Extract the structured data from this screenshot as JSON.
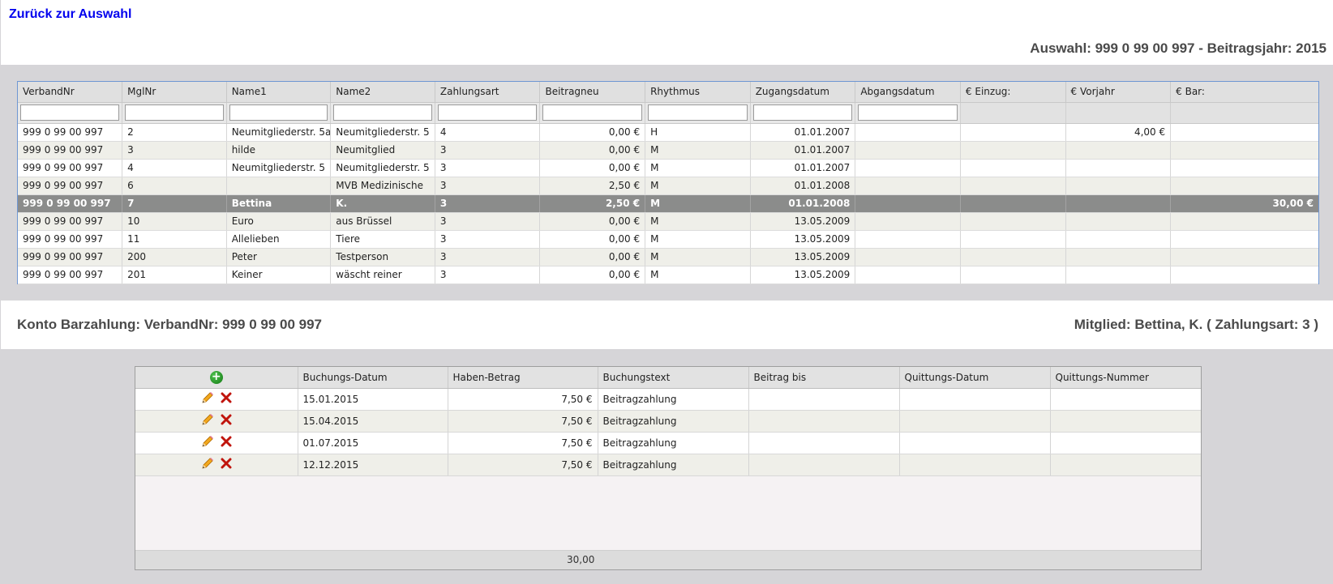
{
  "nav": {
    "back_label": "Zurück zur Auswahl"
  },
  "selection": {
    "heading": "Auswahl: 999 0 99 00 997 - Beitragsjahr: 2015"
  },
  "members_grid": {
    "columns": [
      "VerbandNr",
      "MglNr",
      "Name1",
      "Name2",
      "Zahlungsart",
      "Beitragneu",
      "Rhythmus",
      "Zugangsdatum",
      "Abgangsdatum",
      "€ Einzug:",
      "€ Vorjahr",
      "€ Bar:"
    ],
    "selected_index": 4,
    "rows": [
      {
        "verbandnr": "999 0 99 00 997",
        "mglnr": "2",
        "name1": "Neumitgliederstr. 5a",
        "name2": "Neumitgliederstr. 5",
        "zahlungsart": "4",
        "beitragneu": "0,00 €",
        "rhythmus": "H",
        "zugang": "01.01.2007",
        "abgang": "",
        "einzug": "",
        "vorjahr": "4,00 €",
        "bar": ""
      },
      {
        "verbandnr": "999 0 99 00 997",
        "mglnr": "3",
        "name1": "hilde",
        "name2": "Neumitglied",
        "zahlungsart": "3",
        "beitragneu": "0,00 €",
        "rhythmus": "M",
        "zugang": "01.01.2007",
        "abgang": "",
        "einzug": "",
        "vorjahr": "",
        "bar": ""
      },
      {
        "verbandnr": "999 0 99 00 997",
        "mglnr": "4",
        "name1": "Neumitgliederstr. 5",
        "name2": "Neumitgliederstr. 5",
        "zahlungsart": "3",
        "beitragneu": "0,00 €",
        "rhythmus": "M",
        "zugang": "01.01.2007",
        "abgang": "",
        "einzug": "",
        "vorjahr": "",
        "bar": ""
      },
      {
        "verbandnr": "999 0 99 00 997",
        "mglnr": "6",
        "name1": "",
        "name2": "MVB Medizinische",
        "zahlungsart": "3",
        "beitragneu": "2,50 €",
        "rhythmus": "M",
        "zugang": "01.01.2008",
        "abgang": "",
        "einzug": "",
        "vorjahr": "",
        "bar": ""
      },
      {
        "verbandnr": "999 0 99 00 997",
        "mglnr": "7",
        "name1": "Bettina",
        "name2": "K.",
        "zahlungsart": "3",
        "beitragneu": "2,50 €",
        "rhythmus": "M",
        "zugang": "01.01.2008",
        "abgang": "",
        "einzug": "",
        "vorjahr": "",
        "bar": "30,00 €"
      },
      {
        "verbandnr": "999 0 99 00 997",
        "mglnr": "10",
        "name1": "Euro",
        "name2": "aus Brüssel",
        "zahlungsart": "3",
        "beitragneu": "0,00 €",
        "rhythmus": "M",
        "zugang": "13.05.2009",
        "abgang": "",
        "einzug": "",
        "vorjahr": "",
        "bar": ""
      },
      {
        "verbandnr": "999 0 99 00 997",
        "mglnr": "11",
        "name1": "Allelieben",
        "name2": "Tiere",
        "zahlungsart": "3",
        "beitragneu": "0,00 €",
        "rhythmus": "M",
        "zugang": "13.05.2009",
        "abgang": "",
        "einzug": "",
        "vorjahr": "",
        "bar": ""
      },
      {
        "verbandnr": "999 0 99 00 997",
        "mglnr": "200",
        "name1": "Peter",
        "name2": "Testperson",
        "zahlungsart": "3",
        "beitragneu": "0,00 €",
        "rhythmus": "M",
        "zugang": "13.05.2009",
        "abgang": "",
        "einzug": "",
        "vorjahr": "",
        "bar": ""
      },
      {
        "verbandnr": "999 0 99 00 997",
        "mglnr": "201",
        "name1": "Keiner",
        "name2": "wäscht reiner",
        "zahlungsart": "3",
        "beitragneu": "0,00 €",
        "rhythmus": "M",
        "zugang": "13.05.2009",
        "abgang": "",
        "einzug": "",
        "vorjahr": "",
        "bar": ""
      }
    ]
  },
  "account": {
    "title": "Konto Barzahlung: VerbandNr: 999 0 99 00 997",
    "member": "Mitglied: Bettina, K. ( Zahlungsart: 3 )"
  },
  "bookings": {
    "columns": [
      "Buchungs-Datum",
      "Haben-Betrag",
      "Buchungstext",
      "Beitrag bis",
      "Quittungs-Datum",
      "Quittungs-Nummer"
    ],
    "rows": [
      {
        "datum": "15.01.2015",
        "betrag": "7,50 €",
        "text": "Beitragzahlung",
        "bis": "",
        "qdatum": "",
        "qnummer": ""
      },
      {
        "datum": "15.04.2015",
        "betrag": "7,50 €",
        "text": "Beitragzahlung",
        "bis": "",
        "qdatum": "",
        "qnummer": ""
      },
      {
        "datum": "01.07.2015",
        "betrag": "7,50 €",
        "text": "Beitragzahlung",
        "bis": "",
        "qdatum": "",
        "qnummer": ""
      },
      {
        "datum": "12.12.2015",
        "betrag": "7,50 €",
        "text": "Beitragzahlung",
        "bis": "",
        "qdatum": "",
        "qnummer": ""
      }
    ],
    "total": "30,00"
  },
  "icons": {
    "add": "add-circle-icon",
    "edit": "pencil-icon",
    "delete": "delete-x-icon"
  },
  "colors": {
    "link": "#0000ee",
    "selected_row": "#8b8c8b",
    "grid_border": "#6f97d3",
    "add_icon": "#1f8f1f",
    "delete_icon": "#c0140c"
  }
}
